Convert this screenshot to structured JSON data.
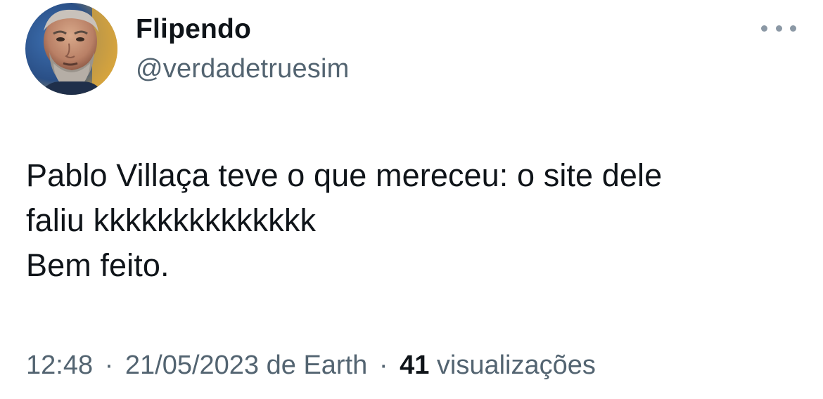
{
  "author": {
    "display_name": "Flipendo",
    "handle": "@verdadetruesim",
    "avatar": "profile-photo"
  },
  "menu": {
    "icon": "more-options-icon"
  },
  "tweet": {
    "lines": [
      "Pablo Villaça teve o que mereceu: o site dele",
      "faliu kkkkkkkkkkkkkk",
      "Bem feito."
    ]
  },
  "meta": {
    "time": "12:48",
    "separator": "·",
    "date": "21/05/2023",
    "source": "de Earth",
    "views_count": "41",
    "views_label": "visualizações"
  },
  "colors": {
    "text_primary": "#0f1419",
    "text_secondary": "#536471",
    "icon_gray": "#8b98a5",
    "background": "#ffffff"
  }
}
